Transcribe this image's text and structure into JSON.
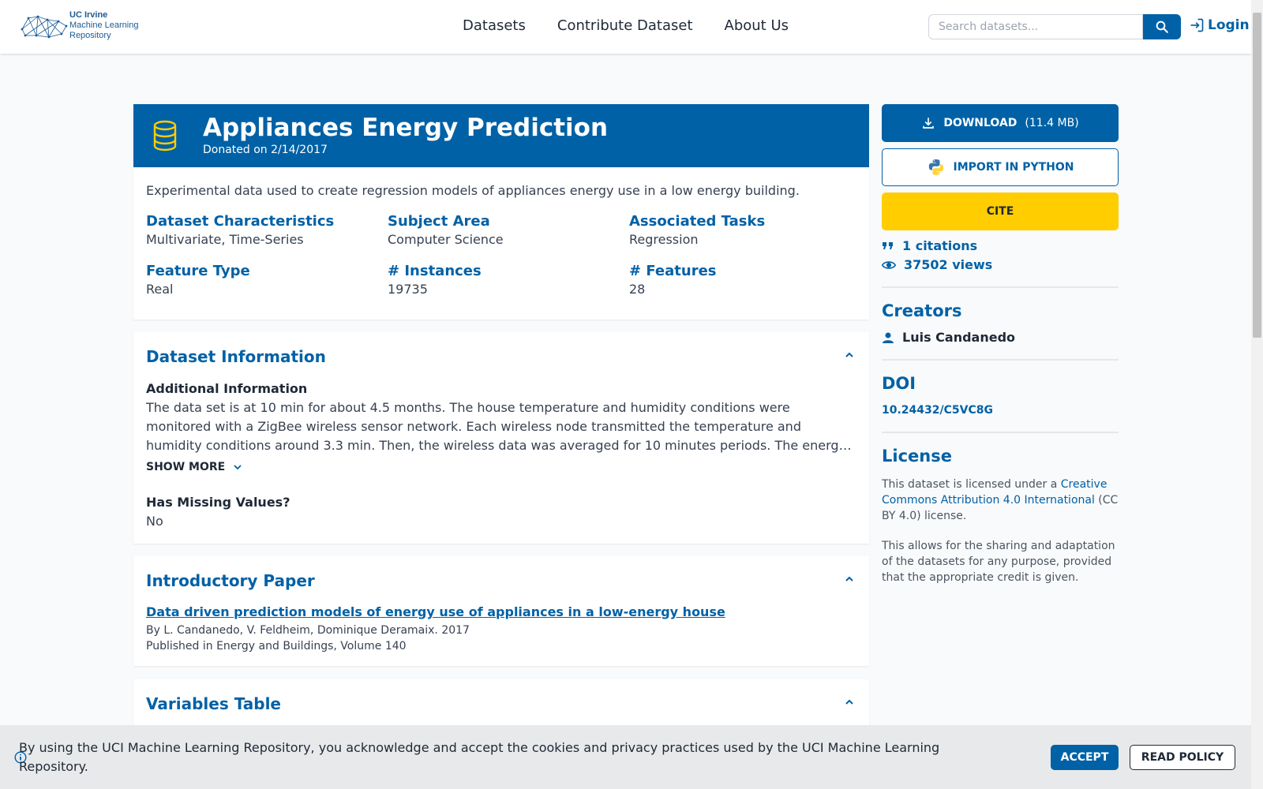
{
  "header": {
    "logo_line1": "UC Irvine",
    "logo_line2": "Machine Learning",
    "logo_line3": "Repository",
    "nav": [
      "Datasets",
      "Contribute Dataset",
      "About Us"
    ],
    "search_placeholder": "Search datasets...",
    "login_label": "Login"
  },
  "dataset": {
    "title": "Appliances Energy Prediction",
    "donated": "Donated on 2/14/2017",
    "description": "Experimental data used to create regression models of appliances energy use in a low energy building.",
    "characteristics": [
      {
        "label": "Dataset Characteristics",
        "value": "Multivariate, Time-Series"
      },
      {
        "label": "Subject Area",
        "value": "Computer Science"
      },
      {
        "label": "Associated Tasks",
        "value": "Regression"
      },
      {
        "label": "Feature Type",
        "value": "Real"
      },
      {
        "label": "# Instances",
        "value": "19735"
      },
      {
        "label": "# Features",
        "value": "28"
      }
    ]
  },
  "info": {
    "heading": "Dataset Information",
    "additional_label": "Additional Information",
    "additional_text": "The data set is at 10 min for about 4.5 months. The house temperature and humidity conditions were monitored with a ZigBee wireless sensor network. Each wireless node transmitted the temperature and humidity conditions around 3.3 min. Then, the wireless data was averaged for 10 minutes periods. The energ…",
    "show_more": "SHOW MORE",
    "missing_label": "Has Missing Values?",
    "missing_value": "No"
  },
  "paper": {
    "heading": "Introductory Paper",
    "title": "Data driven prediction models of energy use of appliances in a low-energy house",
    "authors": "By L. Candanedo, V. Feldheim, Dominique Deramaix. 2017",
    "published": "Published in Energy and Buildings, Volume 140"
  },
  "variables": {
    "heading": "Variables Table"
  },
  "sidebar": {
    "download_label": "DOWNLOAD",
    "download_size": "(11.4 MB)",
    "import_label": "IMPORT IN PYTHON",
    "cite_label": "CITE",
    "citations": "1 citations",
    "views": "37502 views",
    "creators_heading": "Creators",
    "creator": "Luis Candanedo",
    "doi_heading": "DOI",
    "doi": "10.24432/C5VC8G",
    "license_heading": "License",
    "license_pre": "This dataset is licensed under a ",
    "license_link": "Creative Commons Attribution 4.0 International",
    "license_post": " (CC BY 4.0) license.",
    "license_note": "This allows for the sharing and adaptation of the datasets for any purpose, provided that the appropriate credit is given."
  },
  "cookie": {
    "text": "By using the UCI Machine Learning Repository, you acknowledge and accept the cookies and privacy practices used by the UCI Machine Learning Repository.",
    "accept": "ACCEPT",
    "policy": "READ POLICY"
  },
  "colors": {
    "primary": "#0061a6",
    "cite": "#ffcd00"
  }
}
